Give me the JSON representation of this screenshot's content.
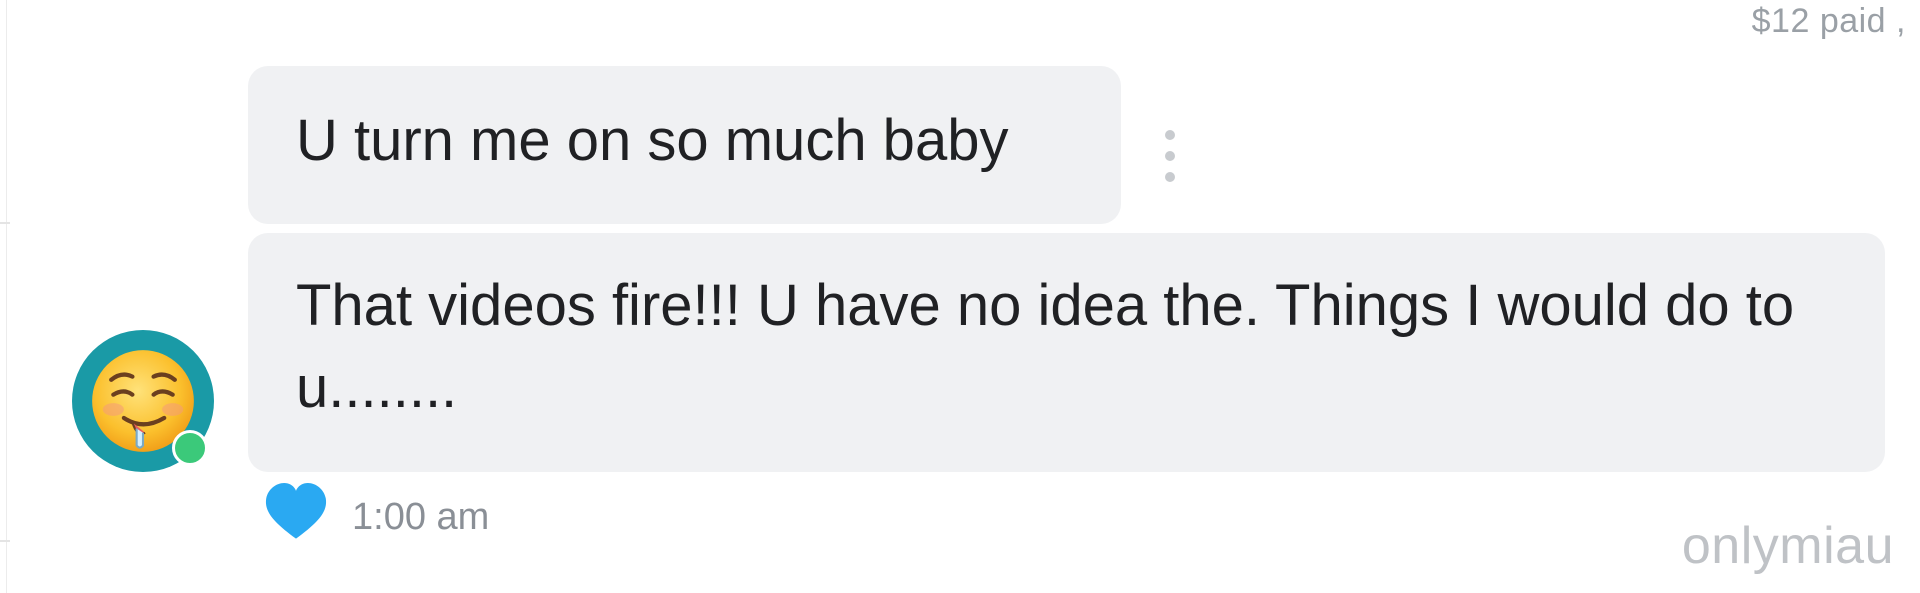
{
  "header": {
    "paid_label": "$12 paid ,"
  },
  "messages": [
    {
      "text": "U turn me on so much baby"
    },
    {
      "text": "That videos fire!!! U have no idea the. Things I would do to u........"
    }
  ],
  "footer": {
    "time": "1:00 am",
    "like_icon": "heart-icon",
    "like_color": "#2aa9f2"
  },
  "sender": {
    "avatar_icon": "drooling-face-emoji",
    "online_status_color": "#3bc97a",
    "avatar_ring_color": "#1a9aa6"
  },
  "watermark": "onlymiau"
}
